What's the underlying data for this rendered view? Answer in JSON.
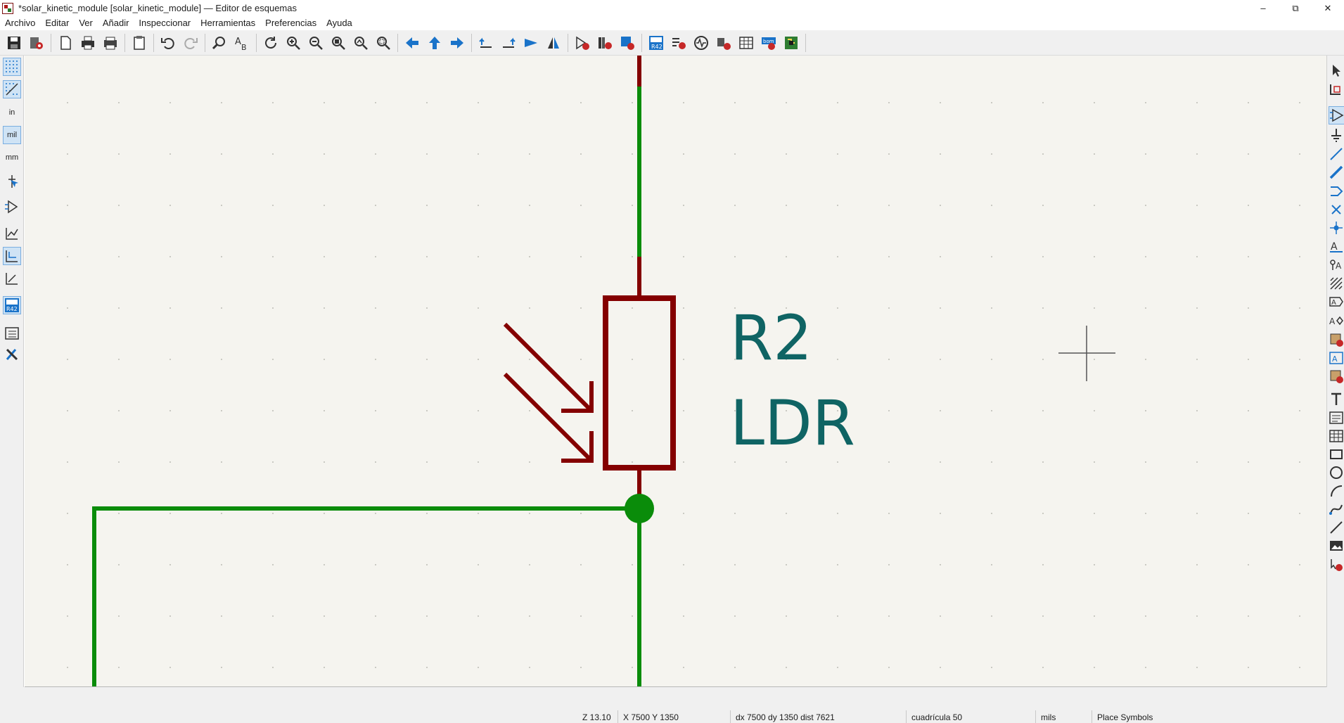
{
  "window": {
    "title": "*solar_kinetic_module [solar_kinetic_module] — Editor de esquemas",
    "controls": [
      "–",
      "⧉",
      "✕"
    ]
  },
  "menu": [
    "Archivo",
    "Editar",
    "Ver",
    "Añadir",
    "Inspeccionar",
    "Herramientas",
    "Preferencias",
    "Ayuda"
  ],
  "left_toolbar": {
    "units_in": "in",
    "units_mil": "mil",
    "units_mm": "mm"
  },
  "schematic": {
    "reference": "R2",
    "value": "LDR",
    "colors": {
      "wire": "#0a8c0a",
      "body": "#840000",
      "text": "#0f6464",
      "background": "#f5f4ef"
    }
  },
  "status": {
    "zoom": "Z 13.10",
    "cursor": "X 7500  Y 1350",
    "delta": "dx 7500  dy 1350  dist 7621",
    "grid": "cuadrícula 50",
    "units": "mils",
    "tool": "Place Symbols"
  }
}
